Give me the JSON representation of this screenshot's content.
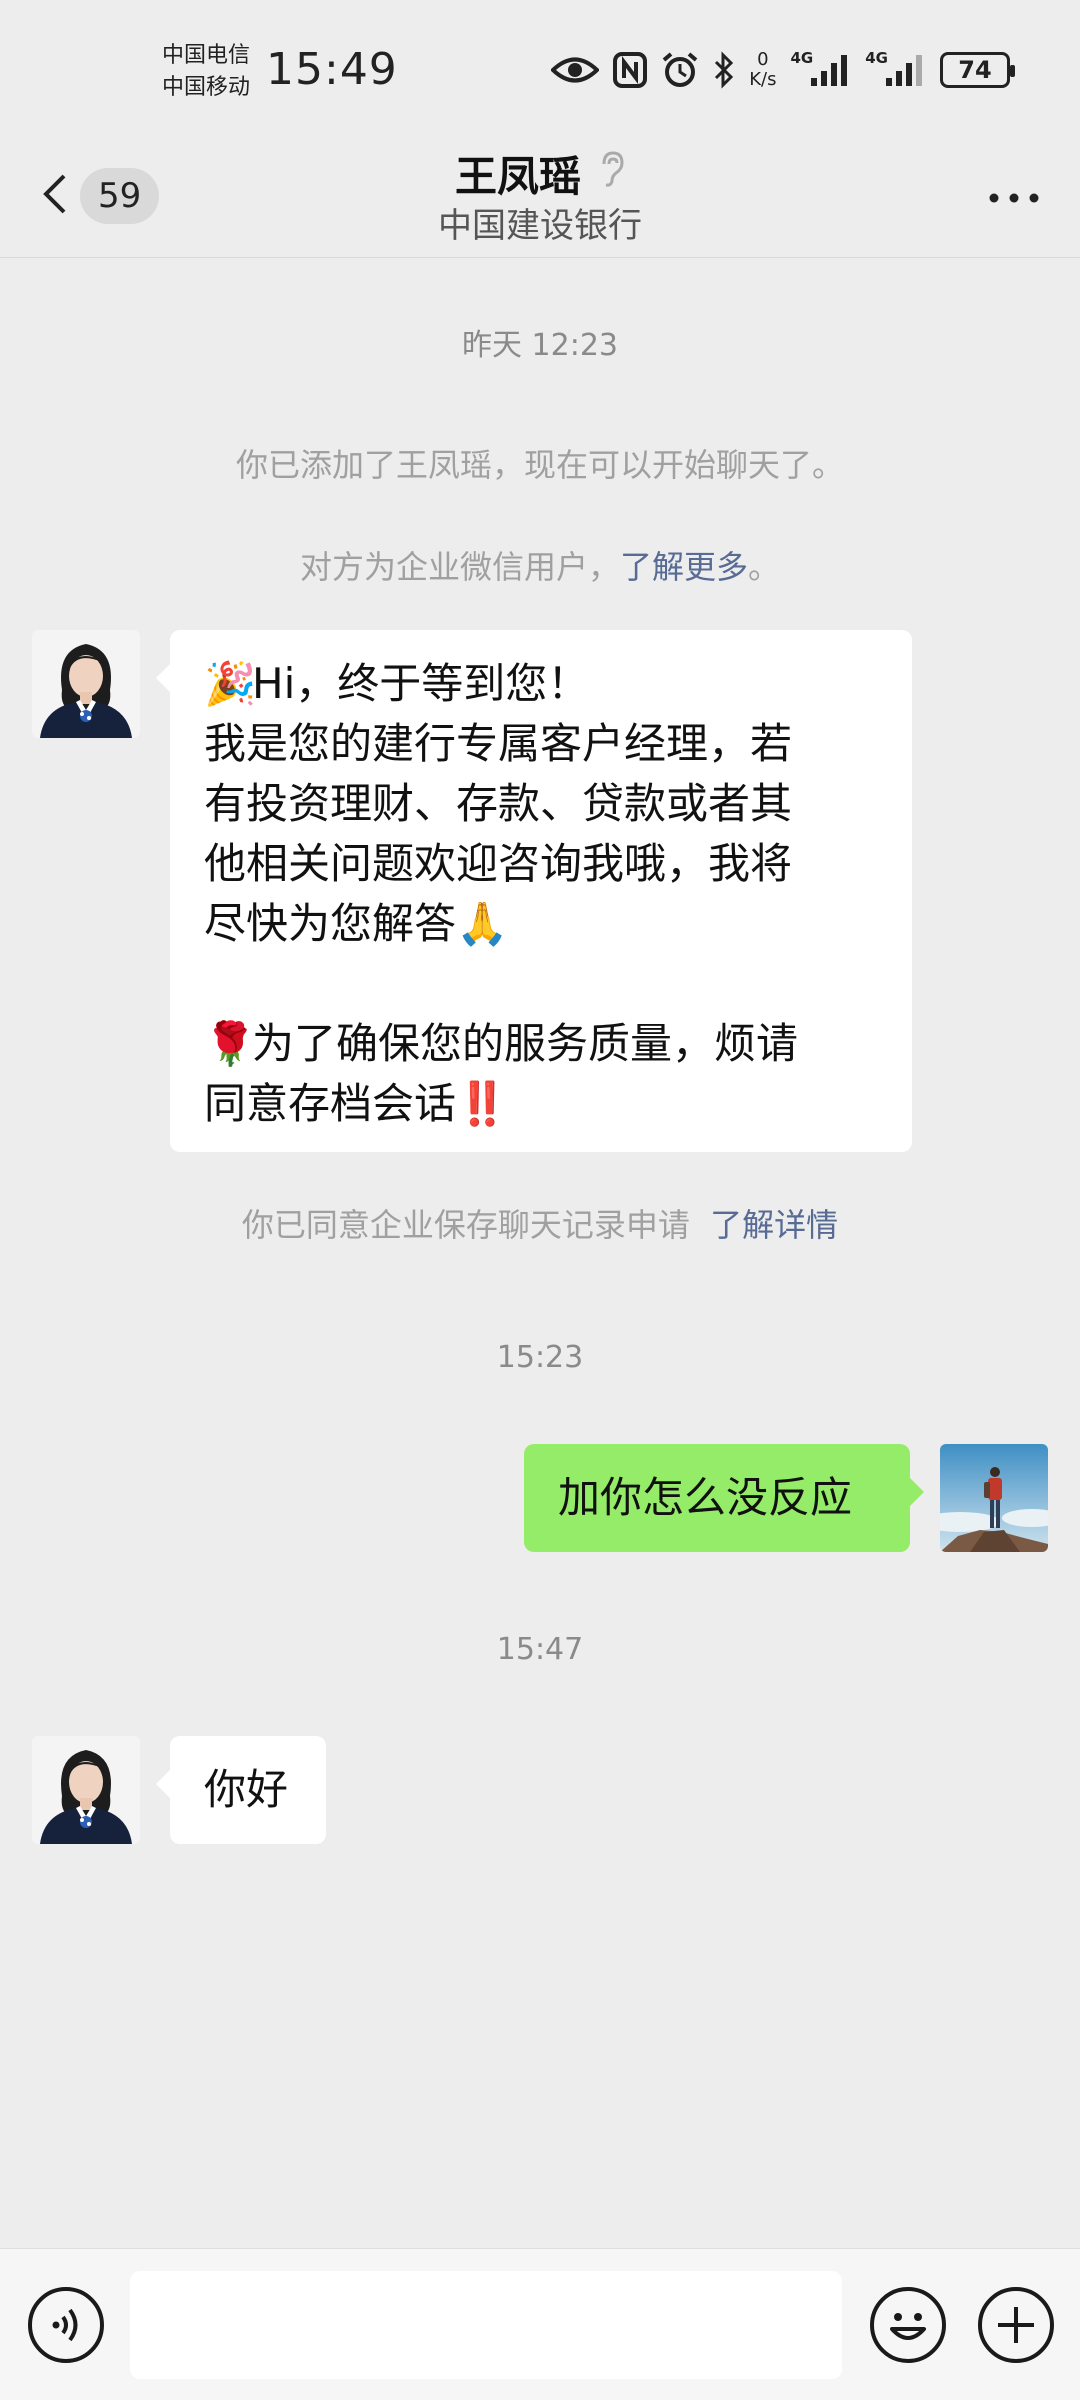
{
  "status_bar": {
    "carrier_1": "中国电信",
    "carrier_2": "中国移动",
    "time": "15:49",
    "net_speed_value": "0",
    "net_speed_unit": "K/s",
    "signal_1_label": "4G",
    "signal_2_label": "4G",
    "battery": "74",
    "icons": [
      "eye-icon",
      "nfc-icon",
      "alarm-icon",
      "bluetooth-icon",
      "signal-icon",
      "battery-icon"
    ]
  },
  "header": {
    "back_badge": "59",
    "title": "王凤瑶",
    "subtitle": "中国建设银行",
    "icons": [
      "back-chevron-icon",
      "ear-icon",
      "more-icon"
    ]
  },
  "messages": {
    "time_1": "昨天 12:23",
    "sys_added": "你已添加了王凤瑶，现在可以开始聊天了。",
    "sys_enterprise_text": "对方为企业微信用户，",
    "sys_enterprise_link": "了解更多",
    "sys_enterprise_end": "。",
    "greeting_lines": [
      "Hi，终于等到您！",
      "我是您的建行专属客户经理，若",
      "有投资理财、存款、贷款或者其",
      "他相关问题欢迎咨询我哦，我将",
      "尽快为您解答",
      "为了确保您的服务质量，烦请",
      "同意存档会话"
    ],
    "greeting_emojis": [
      "🎉",
      "🙏",
      "🌹",
      "‼️"
    ],
    "sys_archive_text": "你已同意企业保存聊天记录申请",
    "sys_archive_link": "了解详情",
    "time_2": "15:23",
    "outgoing_1": "加你怎么没反应",
    "time_3": "15:47",
    "incoming_2": "你好"
  },
  "input_bar": {
    "input_value": "",
    "icons": [
      "voice-icon",
      "emoji-icon",
      "plus-icon"
    ]
  },
  "colors": {
    "background": "#ededed",
    "bubble_incoming": "#ffffff",
    "bubble_outgoing": "#95ec69",
    "link": "#576b95"
  }
}
